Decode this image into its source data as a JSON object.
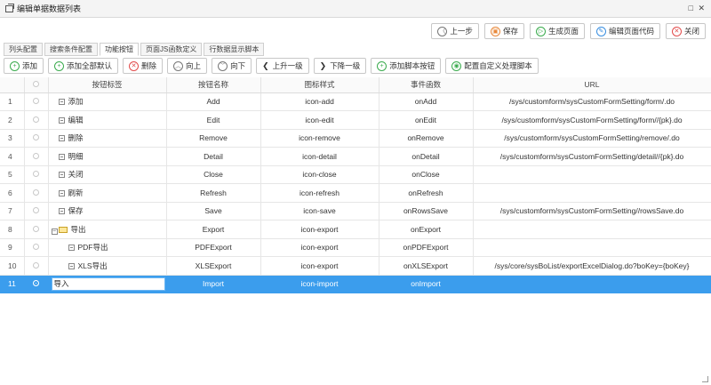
{
  "window": {
    "title": "编辑单据数据列表",
    "maximize_glyph": "□",
    "close_glyph": "✕"
  },
  "top_toolbar": [
    {
      "label": "上一步",
      "icon": "back-icon",
      "glyph": "〈",
      "color": "gray"
    },
    {
      "label": "保存",
      "icon": "save-icon",
      "glyph": "▣",
      "color": "orange"
    },
    {
      "label": "生成页面",
      "icon": "play-icon",
      "glyph": "▷",
      "color": "green"
    },
    {
      "label": "编辑页面代码",
      "icon": "edit-icon",
      "glyph": "✎",
      "color": "blue"
    },
    {
      "label": "关闭",
      "icon": "close-icon",
      "glyph": "✕",
      "color": "red"
    }
  ],
  "tabs": [
    {
      "label": "列头配置",
      "active": false
    },
    {
      "label": "搜索条件配置",
      "active": false
    },
    {
      "label": "功能按钮",
      "active": true
    },
    {
      "label": "页面JS函数定义",
      "active": false
    },
    {
      "label": "行数据显示脚本",
      "active": false
    }
  ],
  "grid_toolbar": [
    {
      "label": "添加",
      "icon": "plus-icon",
      "glyph": "+",
      "color": "green"
    },
    {
      "label": "添加全部默认",
      "icon": "plus-icon",
      "glyph": "+",
      "color": "green"
    },
    {
      "label": "删除",
      "icon": "delete-icon",
      "glyph": "✕",
      "color": "red"
    },
    {
      "label": "向上",
      "icon": "up-icon",
      "glyph": "︿",
      "color": "gray"
    },
    {
      "label": "向下",
      "icon": "down-icon",
      "glyph": "﹀",
      "color": "gray"
    },
    {
      "label": "上升一级",
      "icon": "chevron-left-icon",
      "glyph": "❮",
      "color": "arrow"
    },
    {
      "label": "下降一级",
      "icon": "chevron-right-icon",
      "glyph": "❯",
      "color": "arrow"
    },
    {
      "label": "添加脚本按钮",
      "icon": "plus-icon",
      "glyph": "+",
      "color": "green"
    },
    {
      "label": "配置自定义处理脚本",
      "icon": "eye-icon",
      "glyph": "◉",
      "color": "green"
    }
  ],
  "table": {
    "headers": [
      "",
      "",
      "按钮标签",
      "按钮名称",
      "图标样式",
      "事件函数",
      "URL"
    ],
    "rows": [
      {
        "num": "1",
        "label": "添加",
        "name": "Add",
        "icon": "icon-add",
        "event": "onAdd",
        "url": "/sys/customform/sysCustomFormSetting/form/.do",
        "level": 0,
        "type": "leaf"
      },
      {
        "num": "2",
        "label": "编辑",
        "name": "Edit",
        "icon": "icon-edit",
        "event": "onEdit",
        "url": "/sys/customform/sysCustomFormSetting/form//{pk}.do",
        "level": 0,
        "type": "leaf"
      },
      {
        "num": "3",
        "label": "删除",
        "name": "Remove",
        "icon": "icon-remove",
        "event": "onRemove",
        "url": "/sys/customform/sysCustomFormSetting/remove/.do",
        "level": 0,
        "type": "leaf"
      },
      {
        "num": "4",
        "label": "明细",
        "name": "Detail",
        "icon": "icon-detail",
        "event": "onDetail",
        "url": "/sys/customform/sysCustomFormSetting/detail//{pk}.do",
        "level": 0,
        "type": "leaf"
      },
      {
        "num": "5",
        "label": "关闭",
        "name": "Close",
        "icon": "icon-close",
        "event": "onClose",
        "url": "",
        "level": 0,
        "type": "leaf"
      },
      {
        "num": "6",
        "label": "刷新",
        "name": "Refresh",
        "icon": "icon-refresh",
        "event": "onRefresh",
        "url": "",
        "level": 0,
        "type": "leaf"
      },
      {
        "num": "7",
        "label": "保存",
        "name": "Save",
        "icon": "icon-save",
        "event": "onRowsSave",
        "url": "/sys/customform/sysCustomFormSetting//rowsSave.do",
        "level": 0,
        "type": "leaf"
      },
      {
        "num": "8",
        "label": "导出",
        "name": "Export",
        "icon": "icon-export",
        "event": "onExport",
        "url": "",
        "level": 0,
        "type": "folder"
      },
      {
        "num": "9",
        "label": "PDF导出",
        "name": "PDFExport",
        "icon": "icon-export",
        "event": "onPDFExport",
        "url": "",
        "level": 1,
        "type": "leaf"
      },
      {
        "num": "10",
        "label": "XLS导出",
        "name": "XLSExport",
        "icon": "icon-export",
        "event": "onXLSExport",
        "url": "/sys/core/sysBoList/exportExcelDialog.do?boKey={boKey}",
        "level": 1,
        "type": "leaf"
      },
      {
        "num": "11",
        "label": "导入",
        "name": "Import",
        "icon": "icon-import",
        "event": "onImport",
        "url": "",
        "level": 0,
        "type": "editing",
        "selected": true
      }
    ]
  },
  "colors": {
    "selected_row": "#3b9ded",
    "green": "#3aab4d",
    "red": "#e24b4b",
    "blue": "#3a8fe0",
    "orange": "#e8883a"
  }
}
